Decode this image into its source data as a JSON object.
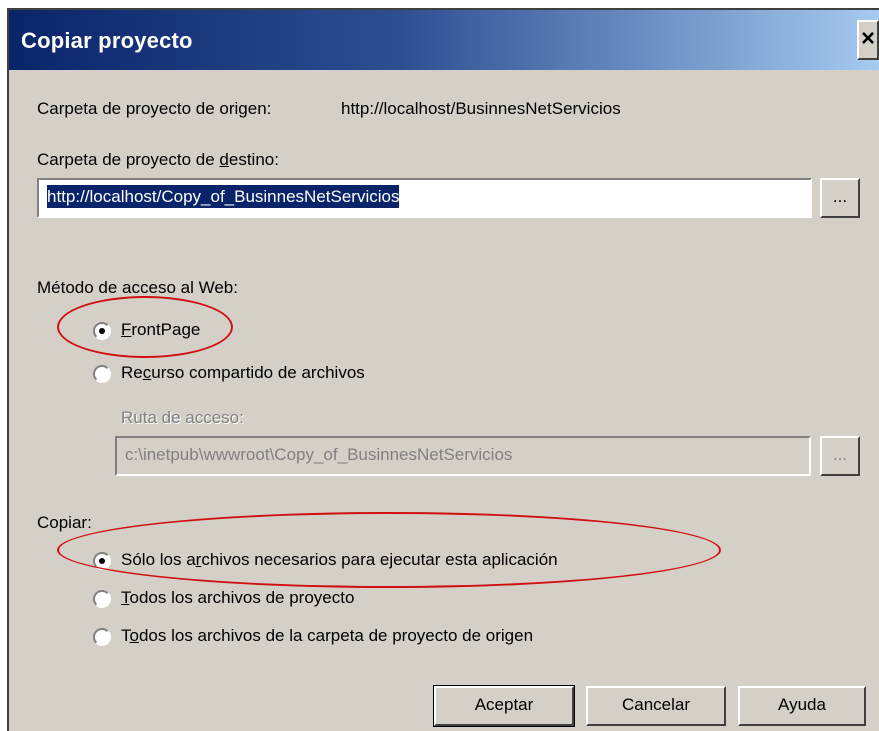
{
  "window": {
    "title": "Copiar proyecto",
    "close_label": "×"
  },
  "source": {
    "label": "Carpeta de proyecto de origen:",
    "value": "http://localhost/BusinnesNetServicios"
  },
  "destination": {
    "label": "Carpeta de proyecto de destino:",
    "value": "http://localhost/Copy_of_BusinnesNetServicios",
    "browse_label": "..."
  },
  "access_method": {
    "label": "Método de acceso al Web:",
    "options": [
      {
        "label": "FrontPage",
        "selected": true
      },
      {
        "label": "Recurso compartido de archivos",
        "selected": false
      }
    ],
    "path_label": "Ruta de acceso:",
    "path_value": "c:\\inetpub\\wwwroot\\Copy_of_BusinnesNetServicios",
    "path_browse_label": "..."
  },
  "copy": {
    "label": "Copiar:",
    "options": [
      {
        "label": "Sólo los archivos necesarios para ejecutar esta aplicación",
        "selected": true
      },
      {
        "label": "Todos los archivos de proyecto",
        "selected": false
      },
      {
        "label": "Todos los archivos de la carpeta de proyecto de origen",
        "selected": false
      }
    ]
  },
  "buttons": {
    "ok": "Aceptar",
    "cancel": "Cancelar",
    "help": "Ayuda"
  },
  "colors": {
    "titlebar_start": "#0a246a",
    "titlebar_end": "#a6caf0",
    "dialog_face": "#d4d0c8",
    "highlight_ellipse": "#d01010"
  }
}
